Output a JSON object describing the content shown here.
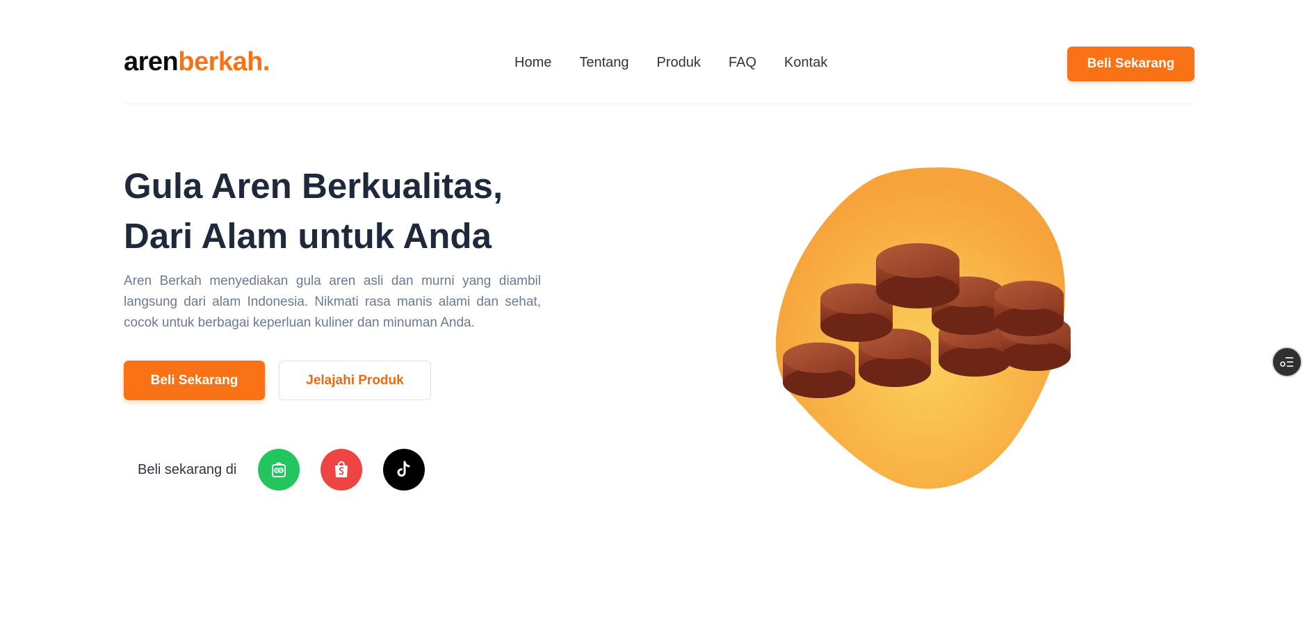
{
  "brand": {
    "name_dark": "aren",
    "name_orange": "berkah",
    "dot": "."
  },
  "nav": {
    "links": [
      "Home",
      "Tentang",
      "Produk",
      "FAQ",
      "Kontak"
    ],
    "cta": "Beli Sekarang"
  },
  "hero": {
    "title_line1": "Gula Aren Berkualitas,",
    "title_line2": "Dari Alam untuk Anda",
    "description": "Aren Berkah menyediakan gula aren asli dan murni yang diambil langsung dari alam Indonesia. Nikmati rasa manis alami dan sehat, cocok untuk berbagai keperluan kuliner dan minuman Anda.",
    "primary_button": "Beli Sekarang",
    "secondary_button": "Jelajahi Produk",
    "buy_label": "Beli sekarang di",
    "stores": [
      {
        "name": "tokopedia",
        "icon": "tokopedia-icon",
        "color": "#22c55e"
      },
      {
        "name": "shopee",
        "icon": "shopee-icon",
        "color": "#ef4444"
      },
      {
        "name": "tiktok",
        "icon": "tiktok-icon",
        "color": "#000000"
      }
    ],
    "image_icon": "palm-sugar-product-image"
  },
  "floating_button": {
    "icon": "settings-list-icon"
  },
  "colors": {
    "accent": "#f97316",
    "heading": "#1e293b",
    "body_text": "#6b7a90",
    "blob_outer": "#f7a33c",
    "blob_inner": "#fbd15a"
  }
}
